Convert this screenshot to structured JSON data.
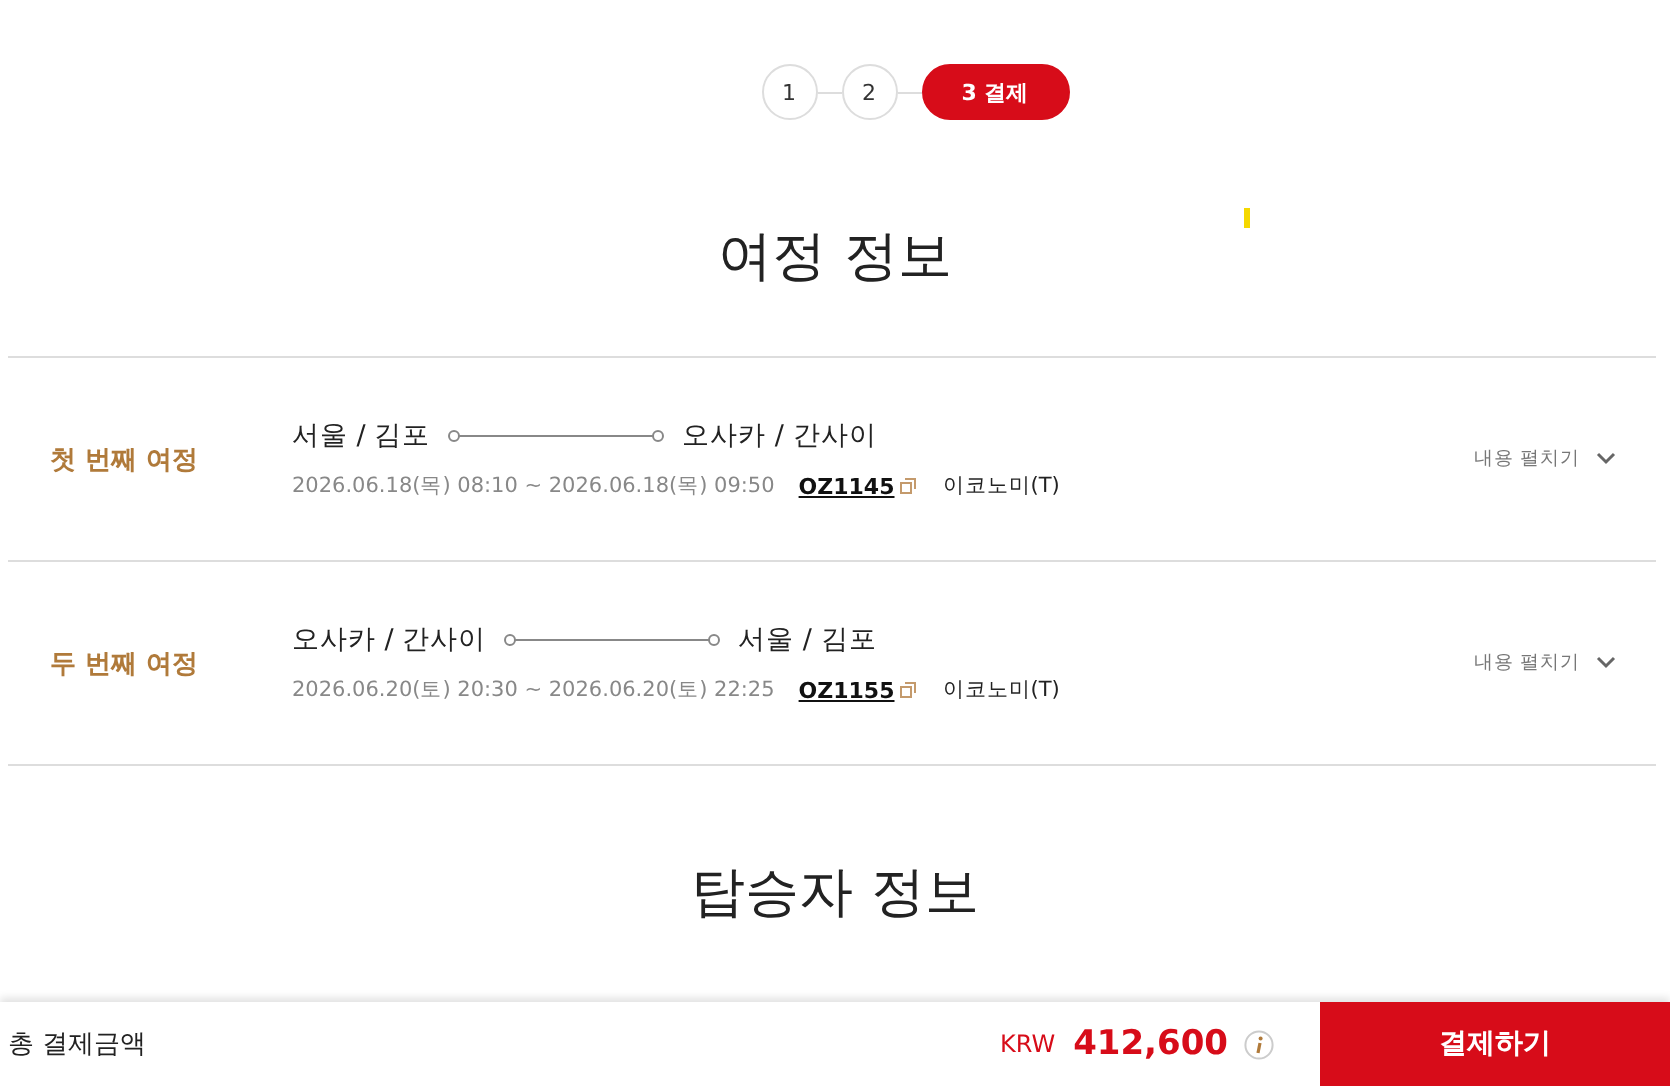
{
  "steps": [
    {
      "label": "1",
      "selected": false
    },
    {
      "label": "2",
      "selected": false
    },
    {
      "label": "3 결제",
      "selected": true
    }
  ],
  "itinerary": {
    "title": "여정 정보",
    "trips": [
      {
        "label": "첫 번째 여정",
        "from": "서울 / 김포",
        "to": "오사카 / 간사이",
        "schedule": "2026.06.18(목) 08:10 ~ 2026.06.18(목) 09:50",
        "flight": "OZ1145",
        "cabin": "이코노미(T)",
        "toggle": "내용 펼치기",
        "expanded": false
      },
      {
        "label": "두 번째 여정",
        "from": "오사카 / 간사이",
        "to": "서울 / 김포",
        "schedule": "2026.06.20(토) 20:30 ~ 2026.06.20(토) 22:25",
        "flight": "OZ1155",
        "cabin": "이코노미(T)",
        "toggle": "내용 펼치기",
        "expanded": false
      }
    ]
  },
  "passengers": {
    "title": "탑승자 정보"
  },
  "footer": {
    "total_label": "총 결제금액",
    "currency": "KRW",
    "amount": "412,600",
    "pay_button": "결제하기"
  }
}
